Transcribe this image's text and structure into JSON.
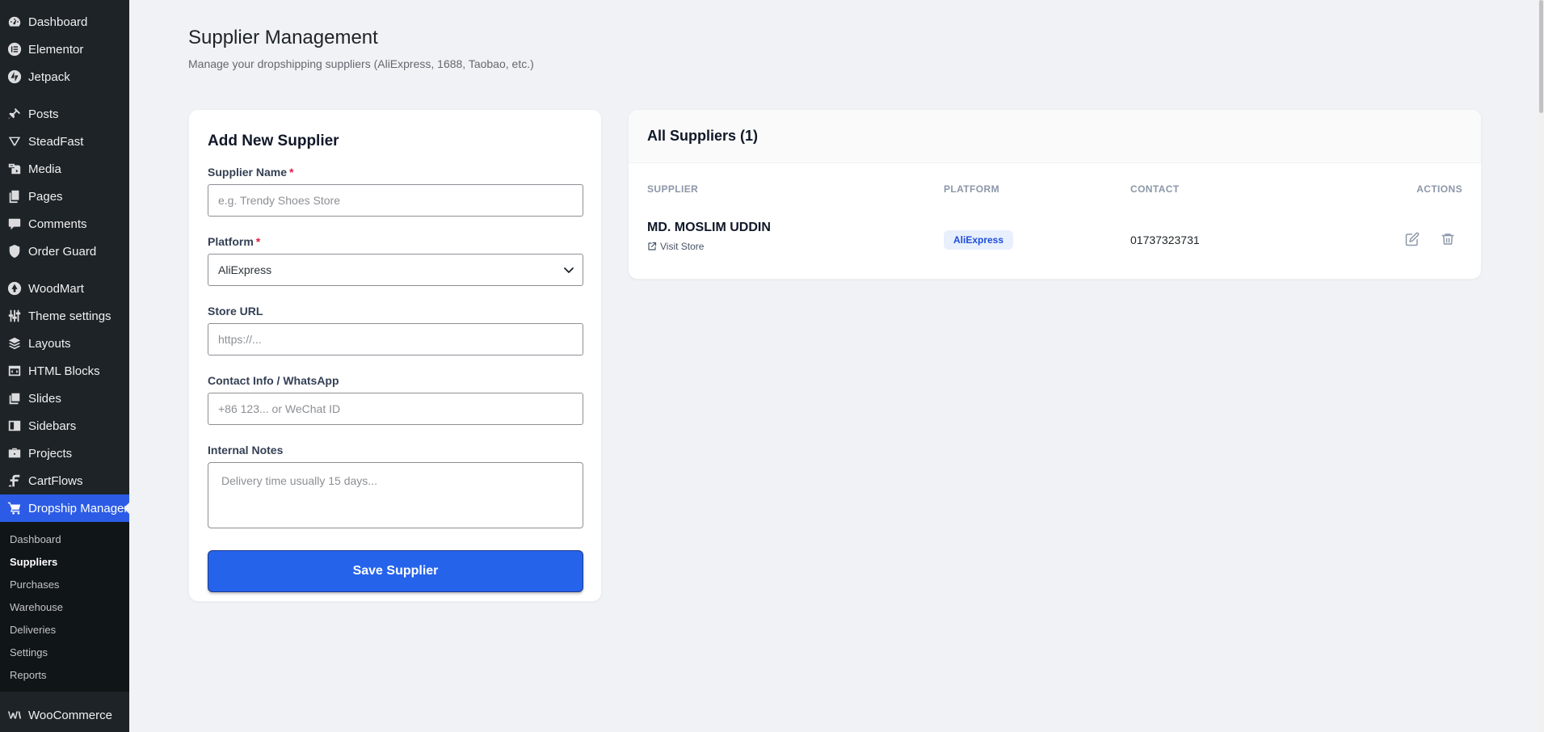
{
  "sidebar": {
    "items": [
      {
        "label": "Dashboard",
        "icon": "dashboard-icon"
      },
      {
        "label": "Elementor",
        "icon": "elementor-icon"
      },
      {
        "label": "Jetpack",
        "icon": "jetpack-icon"
      },
      {
        "label": "Posts",
        "icon": "pin-icon"
      },
      {
        "label": "SteadFast",
        "icon": "steadfast-icon"
      },
      {
        "label": "Media",
        "icon": "media-icon"
      },
      {
        "label": "Pages",
        "icon": "pages-icon"
      },
      {
        "label": "Comments",
        "icon": "comment-icon"
      },
      {
        "label": "Order Guard",
        "icon": "shield-icon"
      },
      {
        "label": "WoodMart",
        "icon": "woodmart-icon"
      },
      {
        "label": "Theme settings",
        "icon": "sliders-icon"
      },
      {
        "label": "Layouts",
        "icon": "layers-icon"
      },
      {
        "label": "HTML Blocks",
        "icon": "html-block-icon"
      },
      {
        "label": "Slides",
        "icon": "slides-icon"
      },
      {
        "label": "Sidebars",
        "icon": "sidebar-layout-icon"
      },
      {
        "label": "Projects",
        "icon": "briefcase-icon"
      },
      {
        "label": "CartFlows",
        "icon": "cartflows-icon"
      },
      {
        "label": "Dropship Manager",
        "icon": "cart-icon"
      }
    ],
    "submenu": [
      "Dashboard",
      "Suppliers",
      "Purchases",
      "Warehouse",
      "Deliveries",
      "Settings",
      "Reports"
    ],
    "woocommerce": "WooCommerce"
  },
  "page": {
    "title": "Supplier Management",
    "subtitle": "Manage your dropshipping suppliers (AliExpress, 1688, Taobao, etc.)"
  },
  "form": {
    "title": "Add New Supplier",
    "name_label": "Supplier Name",
    "name_placeholder": "e.g. Trendy Shoes Store",
    "platform_label": "Platform",
    "platform_value": "AliExpress",
    "url_label": "Store URL",
    "url_placeholder": "https://...",
    "contact_label": "Contact Info / WhatsApp",
    "contact_placeholder": "+86 123... or WeChat ID",
    "notes_label": "Internal Notes",
    "notes_placeholder": "Delivery time usually 15 days...",
    "required_mark": "*",
    "save_label": "Save Supplier"
  },
  "list": {
    "title": "All Suppliers (1)",
    "columns": {
      "supplier": "SUPPLIER",
      "platform": "PLATFORM",
      "contact": "CONTACT",
      "actions": "ACTIONS"
    },
    "rows": [
      {
        "name": "MD. MOSLIM UDDIN",
        "visit": "Visit Store",
        "platform": "AliExpress",
        "contact": "01737323731"
      }
    ]
  },
  "colors": {
    "accent": "#2563eb",
    "sidebar_bg": "#1d2327",
    "active_menu": "#2c5ce6"
  }
}
